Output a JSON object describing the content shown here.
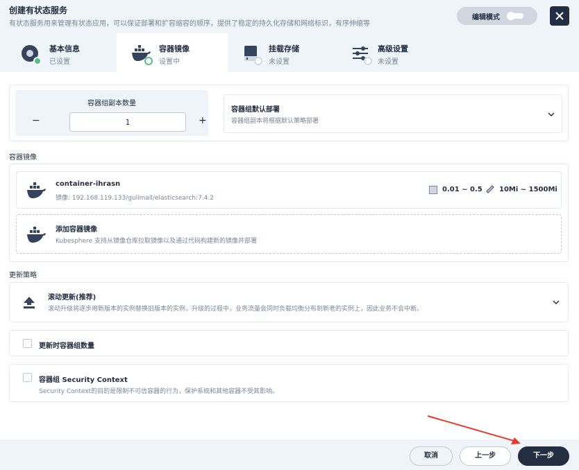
{
  "header": {
    "title": "创建有状态服务",
    "subtitle": "有状态服务用来管理有状态应用，可以保证部署和扩容缩容的顺序，提供了稳定的持久化存储和网络标识，有序伸缩等",
    "edit_mode_label": "编辑模式"
  },
  "tabs": [
    {
      "label": "基本信息",
      "status": "已设置",
      "icon": "basic-info-icon"
    },
    {
      "label": "容器镜像",
      "status": "设置中",
      "icon": "docker-icon"
    },
    {
      "label": "挂载存储",
      "status": "未设置",
      "icon": "storage-icon"
    },
    {
      "label": "高级设置",
      "status": "未设置",
      "icon": "sliders-icon"
    }
  ],
  "replicas": {
    "label": "容器组副本数量",
    "value": "1",
    "minus": "−",
    "plus": "+"
  },
  "deploy_strategy": {
    "title": "容器组默认部署",
    "subtitle": "容器组副本将根据默认策略部署"
  },
  "container_section": {
    "label": "容器镜像",
    "container": {
      "name": "container-ihrasn",
      "image": "镜像: 192.168.119.133/gulimall/elasticsearch:7.4.2",
      "cpu": "0.01 ~ 0.5",
      "memory": "10Mi ~ 1500Mi"
    },
    "add": {
      "title": "添加容器镜像",
      "subtitle": "Kubesphere 支持从镜像仓库拉取镜像以及通过代码构建新的镜像并部署"
    }
  },
  "update_section": {
    "label": "更新策略",
    "strategy_title": "滚动更新(推荐)",
    "strategy_sub": "滚动升级将逐步用新版本的实例替换旧版本的实例，升级的过程中，业务流量会同时负载均衡分布到新老的实例上，因此业务不会中断。",
    "update_replicas_label": "更新时容器组数量",
    "security_context_label": "容器组 Security Context",
    "security_context_sub": "Security Context的目的是限制不可信容器的行为，保护系统和其他容器不受其影响。"
  },
  "footer": {
    "cancel": "取消",
    "prev": "上一步",
    "next": "下一步"
  },
  "colors": {
    "primary_dark": "#242e42",
    "green": "#55bc8a",
    "bg_light": "#eff4f9",
    "annotation_arrow": "#e8392b"
  }
}
